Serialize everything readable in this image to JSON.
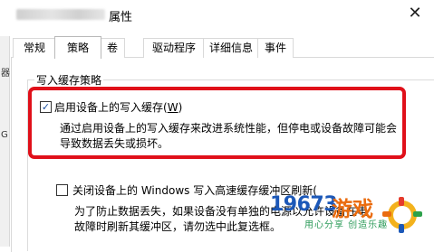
{
  "window": {
    "title_suffix": "属性",
    "close_glyph": "✕"
  },
  "tabs": [
    {
      "label": "常规"
    },
    {
      "label": "策略"
    },
    {
      "label": "卷"
    },
    {
      "label": "驱动程序"
    },
    {
      "label": "详细信息"
    },
    {
      "label": "事件"
    }
  ],
  "active_tab": "策略",
  "group": {
    "title": "写入缓存策略"
  },
  "enable_cache": {
    "checked": true,
    "label_prefix": "启用设备上的写入缓存(",
    "label_key": "W",
    "label_suffix": ")",
    "description_line1": "通过启用设备上的写入缓存来改进系统性能，但停电或设备故障可能会",
    "description_line2": "导致数据丢失或损坏。"
  },
  "flush_option": {
    "checked": false,
    "label": "关闭设备上的 Windows 写入高速缓存缓冲区刷新(",
    "description_line1": "为了防止数据丢失，如果设备没有单独的电源以允许设备在电",
    "description_line2": "故障时刷新其缓冲区，请勿选中此复选框。"
  },
  "left_strip": [
    "器",
    "G"
  ],
  "watermark": {
    "number": "19673",
    "game": "游戏",
    "slogan": "用心分享  创造乐趣"
  },
  "colors": {
    "highlight_frame": "#e0101a",
    "watermark_blue": "#1c58b8",
    "watermark_orange": "#ea6c0f",
    "watermark_green": "#2d9b5a"
  }
}
